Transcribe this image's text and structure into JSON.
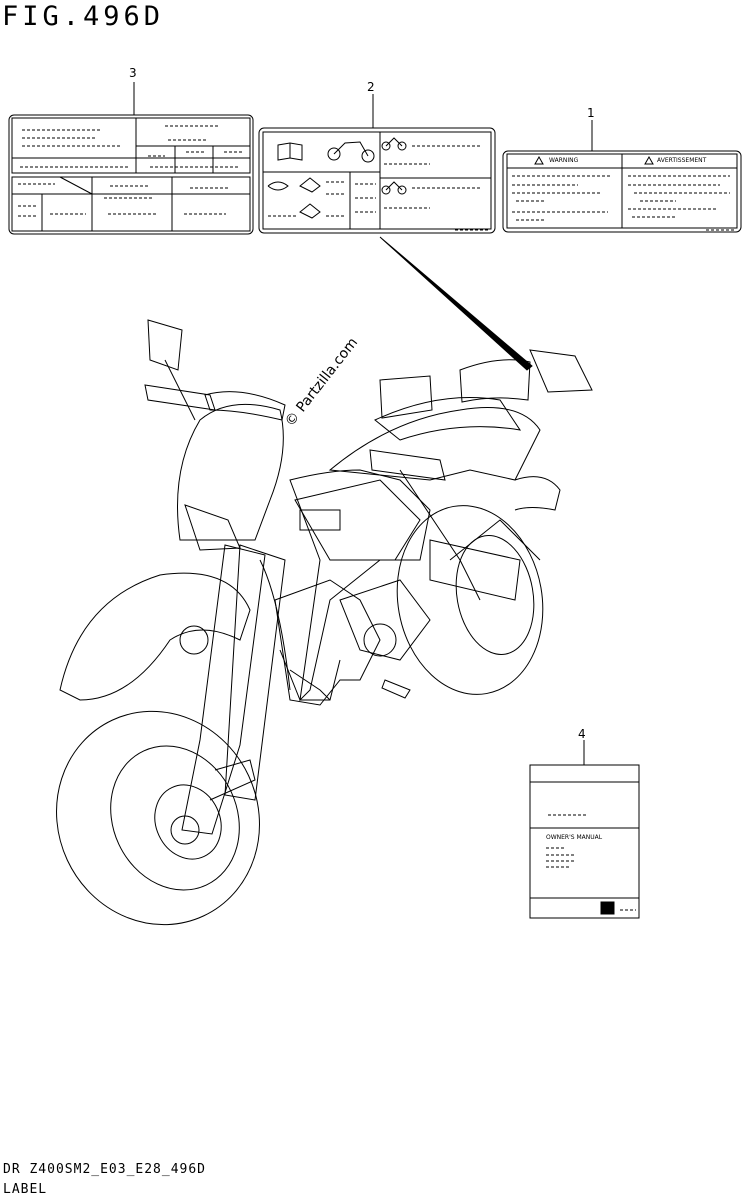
{
  "figure": {
    "title": "FIG.496D"
  },
  "callouts": [
    "1",
    "2",
    "3",
    "4"
  ],
  "labels": {
    "warning": {
      "left_heading": "WARNING",
      "right_heading": "AVERTISSEMENT"
    },
    "manual": {
      "title": "OWNER'S MANUAL"
    }
  },
  "watermark": {
    "text": "© Partzilla.com"
  },
  "footer": {
    "code": "DR Z400SM2_E03_E28_496D",
    "caption": "LABEL"
  }
}
